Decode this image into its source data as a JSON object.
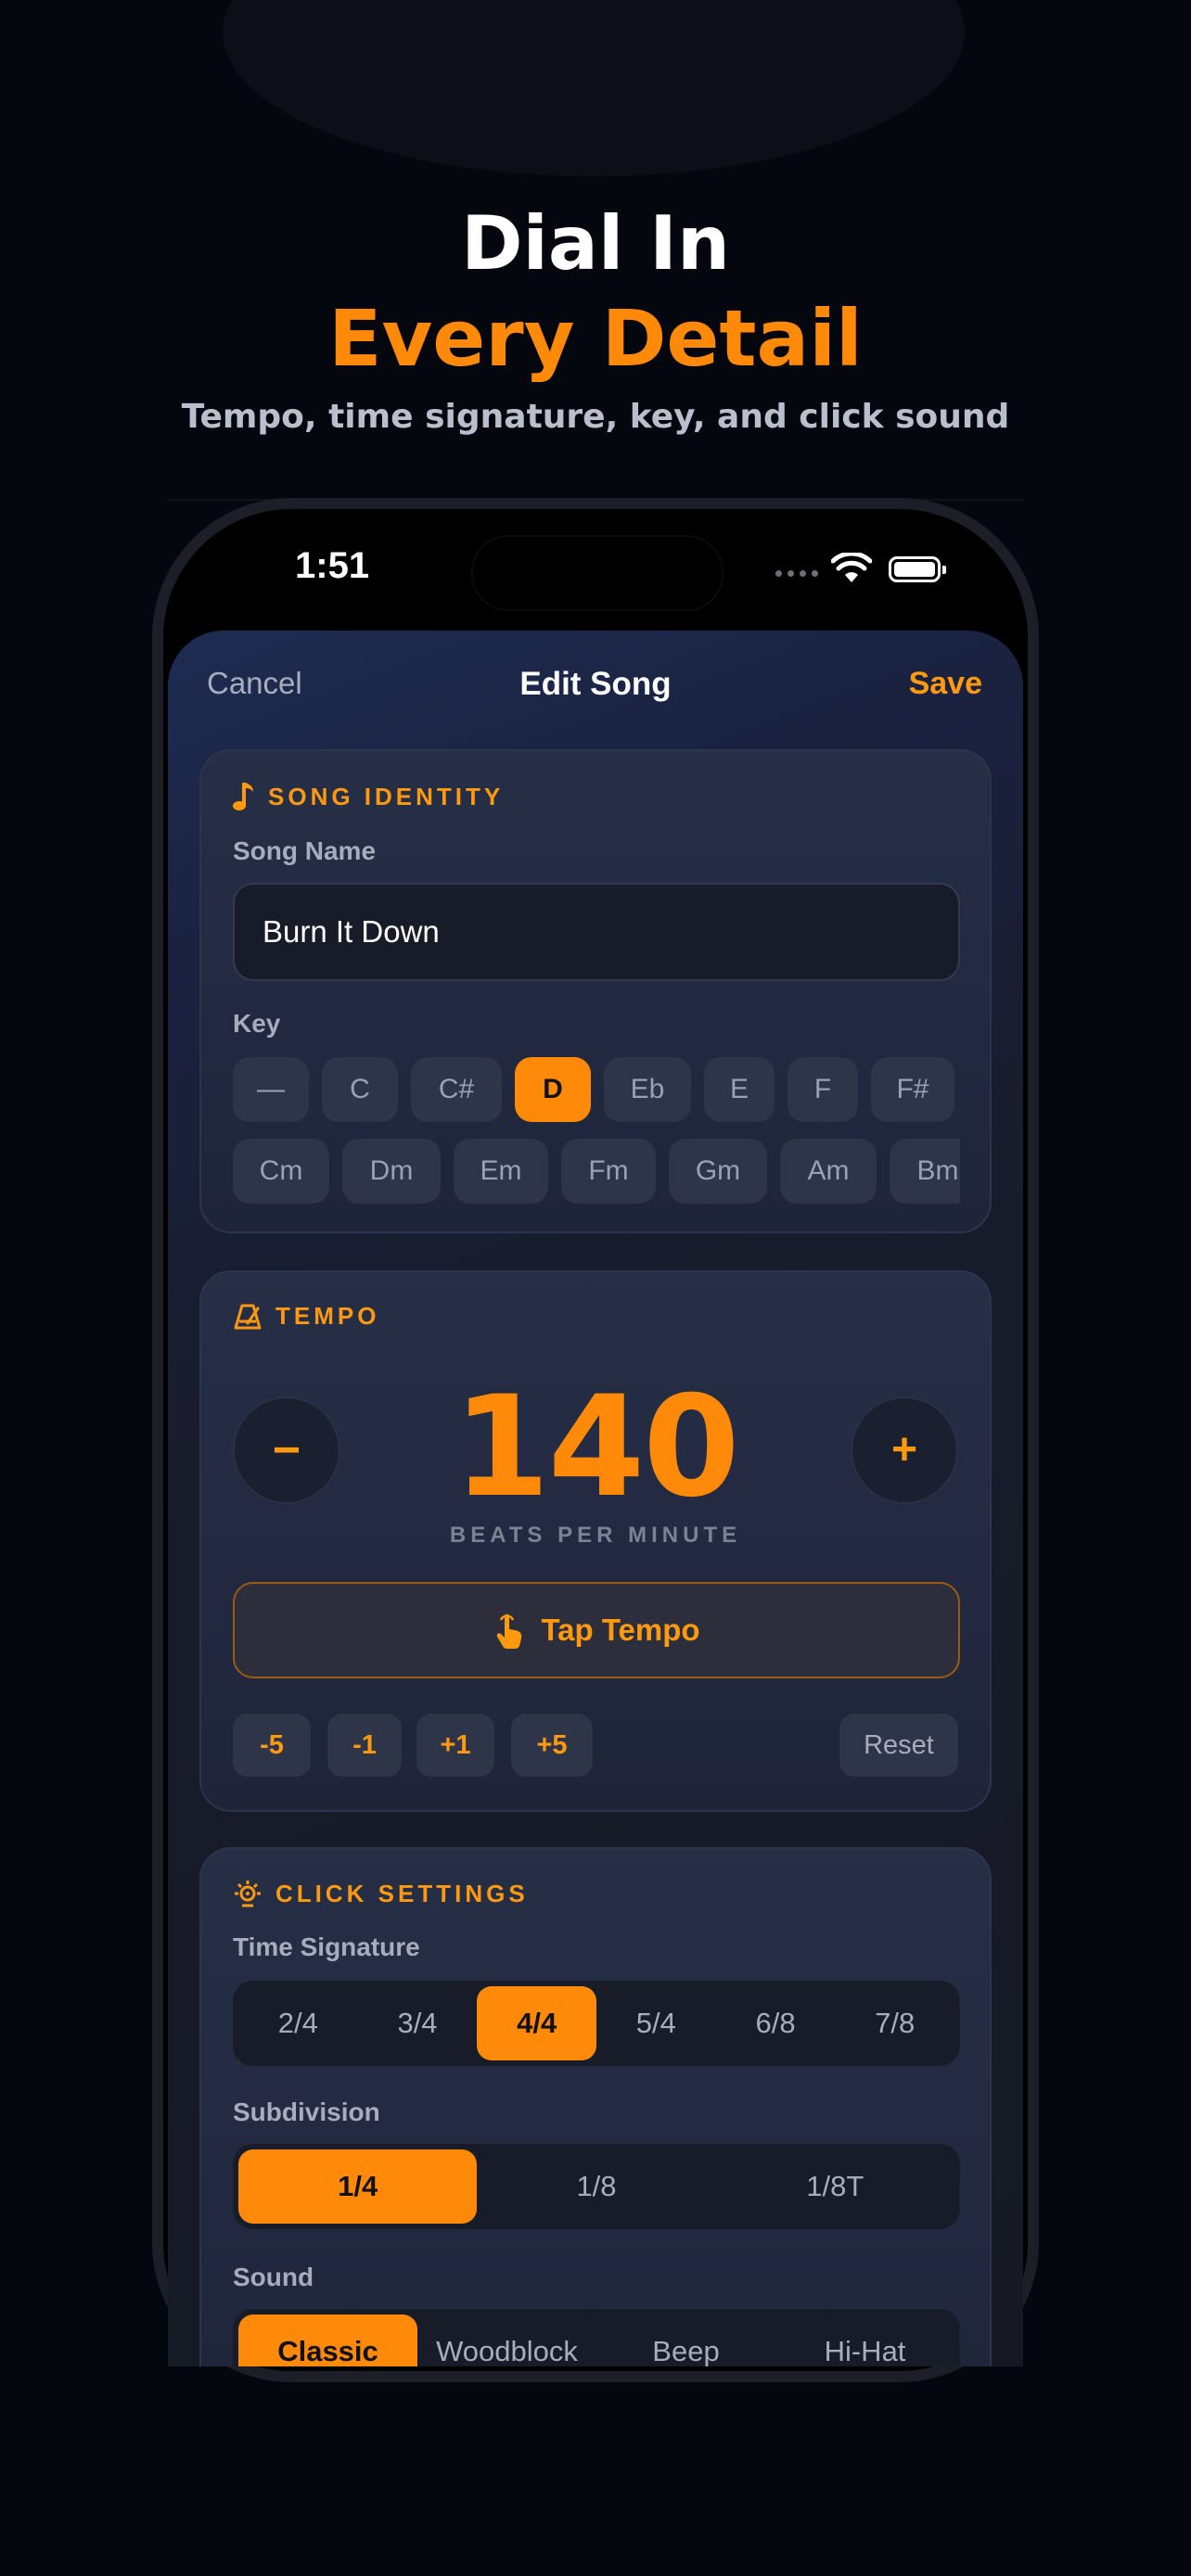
{
  "hero": {
    "line1": "Dial In",
    "line2": "Every Detail",
    "subtitle": "Tempo, time signature, key, and click sound"
  },
  "status_bar": {
    "time": "1:51"
  },
  "nav": {
    "cancel": "Cancel",
    "title": "Edit Song",
    "save": "Save"
  },
  "song_identity": {
    "header": "SONG IDENTITY",
    "name_label": "Song Name",
    "name_value": "Burn It Down",
    "key_label": "Key",
    "keys_row1": [
      "—",
      "C",
      "C#",
      "D",
      "Eb",
      "E",
      "F",
      "F#"
    ],
    "keys_row2": [
      "Cm",
      "Dm",
      "Em",
      "Fm",
      "Gm",
      "Am",
      "Bm"
    ],
    "selected_key": "D"
  },
  "tempo": {
    "header": "TEMPO",
    "minus": "−",
    "plus": "+",
    "bpm": "140",
    "bpm_label": "BEATS PER MINUTE",
    "tap_label": "Tap Tempo",
    "adjust": [
      "-5",
      "-1",
      "+1",
      "+5"
    ],
    "reset": "Reset"
  },
  "click_settings": {
    "header": "CLICK SETTINGS",
    "time_sig_label": "Time Signature",
    "time_signatures": [
      "2/4",
      "3/4",
      "4/4",
      "5/4",
      "6/8",
      "7/8"
    ],
    "selected_time_sig": "4/4",
    "subdivision_label": "Subdivision",
    "subdivisions": [
      "1/4",
      "1/8",
      "1/8T"
    ],
    "selected_subdivision": "1/4",
    "sound_label": "Sound",
    "sounds": [
      "Classic",
      "Woodblock",
      "Beep",
      "Hi-Hat"
    ],
    "selected_sound": "Classic"
  },
  "colors": {
    "accent": "#ff8a0a",
    "background": "#05070f",
    "card": "#232a40"
  }
}
